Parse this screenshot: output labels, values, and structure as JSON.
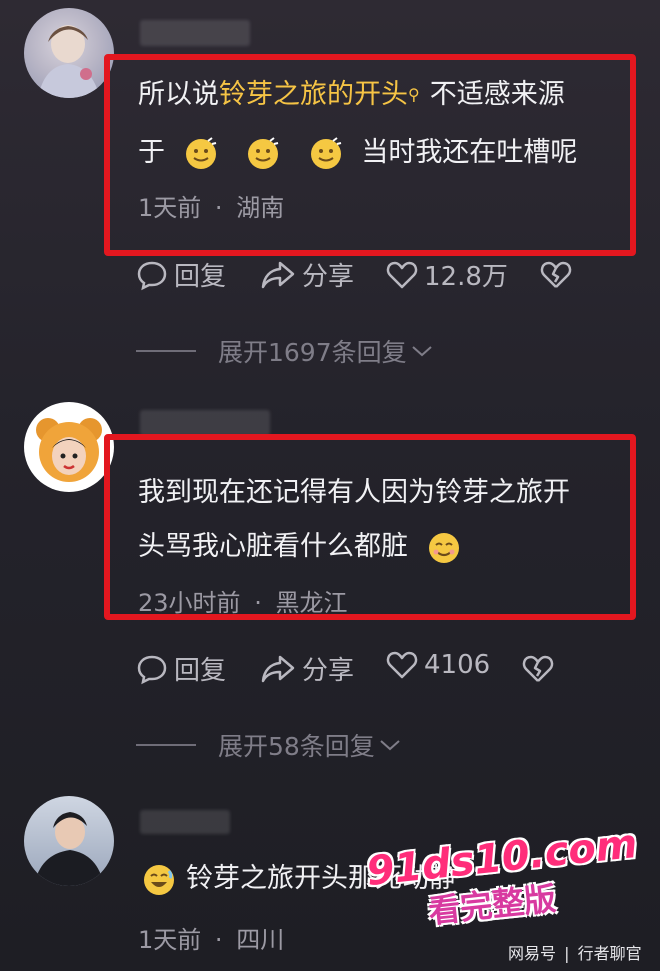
{
  "comments": [
    {
      "text_pre": "所以说",
      "text_link": "铃芽之旅的开头",
      "text_post": "不适感来源",
      "line2_pre": "于",
      "line2_post": "当时我还在吐槽呢",
      "time": "1天前",
      "location": "湖南",
      "reply_label": "回复",
      "share_label": "分享",
      "likes": "12.8万",
      "expand": "展开1697条回复"
    },
    {
      "line1": "我到现在还记得有人因为铃芽之旅开",
      "line2": "头骂我心脏看什么都脏",
      "time": "23小时前",
      "location": "黑龙江",
      "reply_label": "回复",
      "share_label": "分享",
      "likes": "4106",
      "expand": "展开58条回复"
    },
    {
      "line1": "铃芽之旅开头那死动静",
      "time": "1天前",
      "location": "四川"
    }
  ],
  "separator": "·",
  "watermark": {
    "site": "91ds10.com",
    "slogan": "看完整版",
    "source": "网易号",
    "divider": "|",
    "author": "行者聊官"
  },
  "icons": [
    "search-icon",
    "reply-icon",
    "share-icon",
    "heart-icon",
    "broken-heart-icon",
    "chevron-down-icon",
    "emoji-icon"
  ],
  "colors": {
    "highlight": "#f6c445",
    "redbox": "#e3171f",
    "background": "#24232b"
  }
}
